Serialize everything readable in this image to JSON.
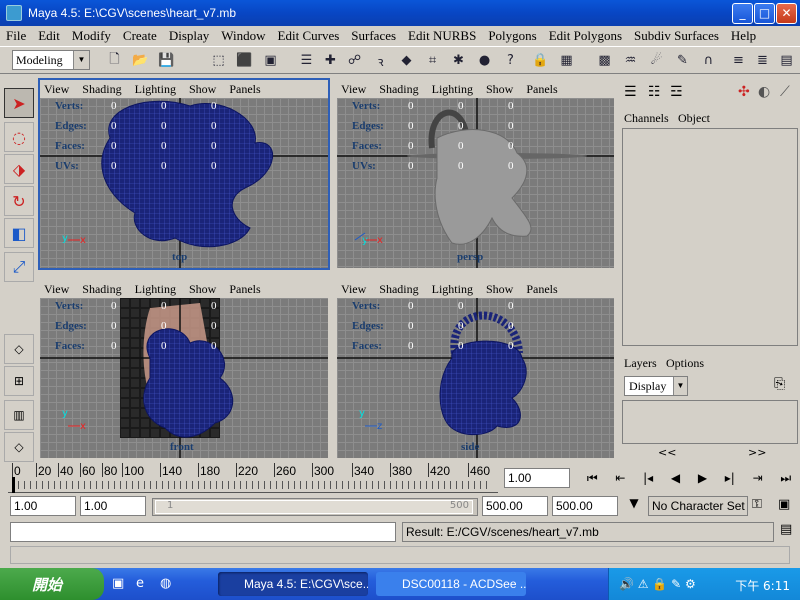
{
  "window": {
    "title": "Maya 4.5: E:\\CGV\\scenes\\heart_v7.mb"
  },
  "menu": [
    "File",
    "Edit",
    "Modify",
    "Create",
    "Display",
    "Window",
    "Edit Curves",
    "Surfaces",
    "Edit NURBS",
    "Polygons",
    "Edit Polygons",
    "Subdiv Surfaces",
    "Help"
  ],
  "toolbar": {
    "mode": "Modeling"
  },
  "viewport_menu": [
    "View",
    "Shading",
    "Lighting",
    "Show",
    "Panels"
  ],
  "hud_labels": {
    "verts": "Verts:",
    "edges": "Edges:",
    "faces": "Faces:",
    "uvs": "UVs:"
  },
  "viewports": [
    {
      "name": "top",
      "active": true,
      "hud": {
        "verts": [
          "0",
          "0",
          "0"
        ],
        "edges": [
          "0",
          "0",
          "0"
        ],
        "faces": [
          "0",
          "0",
          "0"
        ],
        "uvs": [
          "0",
          "0",
          "0"
        ]
      }
    },
    {
      "name": "persp",
      "active": false,
      "hud": {
        "verts": [
          "0",
          "0",
          "0"
        ],
        "edges": [
          "0",
          "0",
          "0"
        ],
        "faces": [
          "0",
          "0",
          "0"
        ],
        "uvs": [
          "0",
          "0",
          "0"
        ]
      }
    },
    {
      "name": "front",
      "active": false,
      "hud": {
        "verts": [
          "0",
          "0",
          "0"
        ],
        "edges": [
          "0",
          "0",
          "0"
        ],
        "faces": [
          "0",
          "0",
          "0"
        ]
      }
    },
    {
      "name": "side",
      "active": false,
      "hud": {
        "verts": [
          "0",
          "0",
          "0"
        ],
        "edges": [
          "0",
          "0",
          "0"
        ],
        "faces": [
          "0",
          "0",
          "0"
        ]
      }
    }
  ],
  "channel_box": {
    "tabs": [
      "Channels",
      "Object"
    ]
  },
  "layers": {
    "tabs": [
      "Layers",
      "Options"
    ],
    "display": "Display",
    "nav": [
      "<<",
      ">>"
    ]
  },
  "timeline": {
    "ticks": [
      "0",
      "20",
      "40",
      "60",
      "80",
      "100",
      "140",
      "180",
      "220",
      "260",
      "300",
      "340",
      "380",
      "420",
      "460"
    ],
    "current_frame": "1.00"
  },
  "range": {
    "start": "1.00",
    "playback_start": "1.00",
    "slider_left": "1",
    "slider_right": "500",
    "playback_end": "500.00",
    "end": "500.00",
    "character_set": "No Character Set"
  },
  "status": {
    "result": "Result: E:/CGV/scenes/heart_v7.mb"
  },
  "taskbar": {
    "start": "開始",
    "tasks": [
      "Maya 4.5: E:\\CGV\\sce...",
      "DSC00118 - ACDSee ..."
    ],
    "clock": "下午 6:11"
  }
}
